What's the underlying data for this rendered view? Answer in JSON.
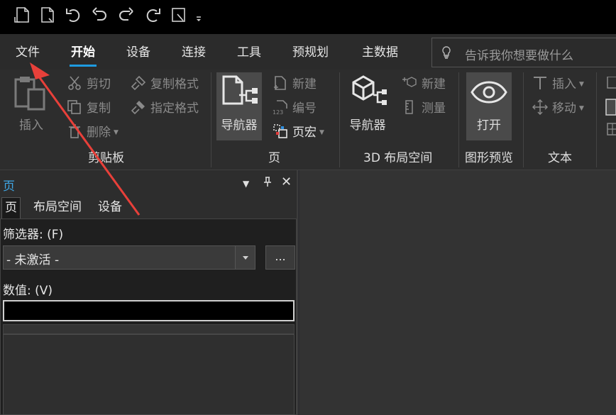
{
  "tabs": [
    "文件",
    "开始",
    "设备",
    "连接",
    "工具",
    "预规划",
    "主数据"
  ],
  "search": {
    "placeholder": "告诉我你想要做什么"
  },
  "clipboard": {
    "insert": "插入",
    "cut": "剪切",
    "copy": "复制",
    "delete": "删除",
    "copy_format": "复制格式",
    "apply_format": "指定格式",
    "label": "剪贴板"
  },
  "page_group": {
    "navigator": "导航器",
    "new": "新建",
    "number": "编号",
    "macro": "页宏",
    "label": "页"
  },
  "layout3d": {
    "navigator": "导航器",
    "new": "新建",
    "measure": "测量",
    "label": "3D 布局空间"
  },
  "preview": {
    "open": "打开",
    "label": "图形预览"
  },
  "text_group": {
    "insert": "插入",
    "move": "移动",
    "label": "文本"
  },
  "panel": {
    "title": "页",
    "tabs": [
      "页",
      "布局空间",
      "设备"
    ],
    "filter_label": "筛选器: (F)",
    "filter_value": "- 未激活 -",
    "ellipsis": "...",
    "value_label": "数值: (V)"
  },
  "colors": {
    "accent": "#1e9be0",
    "annotation_arrow": "#e8403a"
  }
}
